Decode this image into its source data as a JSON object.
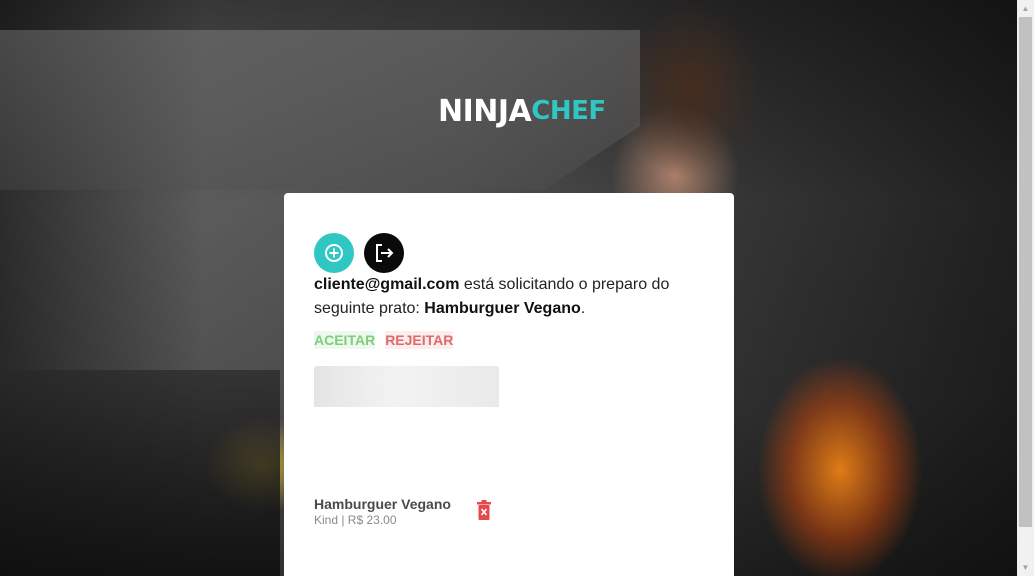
{
  "logo": {
    "part1": "NINJA",
    "part2": "CHEF",
    "accent_color": "#2ec7c4"
  },
  "toolbar": {
    "add_icon": "plus-circle-icon",
    "logout_icon": "logout-icon"
  },
  "request": {
    "email": "cliente@gmail.com",
    "text_middle": " está solicitando o preparo do seguinte prato: ",
    "dish": "Hamburguer Vegano",
    "text_end": "."
  },
  "actions": {
    "accept": "ACEITAR",
    "reject": "REJEITAR"
  },
  "item": {
    "name": "Hamburguer Vegano",
    "meta": "Kind | R$ 23.00",
    "delete_icon": "trash-icon"
  },
  "colors": {
    "accent": "#2ec7c4",
    "accept": "#7ccf7a",
    "reject": "#e06a6a",
    "delete": "#e5484d"
  }
}
